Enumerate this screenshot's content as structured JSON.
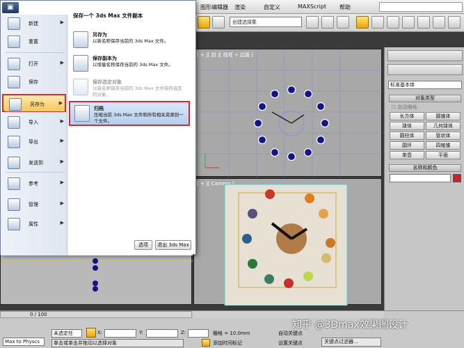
{
  "menubar": {
    "items": [
      "图形编辑器",
      "渲染",
      "自定义",
      "MAXScript",
      "帮助"
    ]
  },
  "toolbar": {
    "selection_set_placeholder": "创建选择集"
  },
  "viewports": {
    "top_label": "[ + ][ 前 ][ 线框 + 边面 ]",
    "camera_label": "[ + ][ Camera ]"
  },
  "app_menu": {
    "title": "保存一个 3ds Max 文件副本",
    "left_items": [
      {
        "label": "新建",
        "icon": "new-file-icon",
        "arrow": true
      },
      {
        "label": "重置",
        "icon": "reset-icon",
        "arrow": false
      },
      {
        "label": "打开",
        "icon": "open-folder-icon",
        "arrow": true
      },
      {
        "label": "保存",
        "icon": "save-icon",
        "arrow": false
      },
      {
        "label": "另存为",
        "icon": "save-as-icon",
        "arrow": true
      },
      {
        "label": "导入",
        "icon": "import-icon",
        "arrow": true
      },
      {
        "label": "导出",
        "icon": "export-icon",
        "arrow": true
      },
      {
        "label": "发送到",
        "icon": "send-to-icon",
        "arrow": true
      },
      {
        "label": "参考",
        "icon": "reference-icon",
        "arrow": true
      },
      {
        "label": "管理",
        "icon": "manage-icon",
        "arrow": true
      },
      {
        "label": "属性",
        "icon": "properties-icon",
        "arrow": true
      }
    ],
    "right_items": [
      {
        "title": "另存为",
        "desc": "以新名称保存当前的 3ds Max 文件。"
      },
      {
        "title": "保存副本为",
        "desc": "以增量名称保存当前的 3ds Max 文件。"
      },
      {
        "title": "保存选定对象",
        "desc": "以新名称保存当前的 3ds Max 文件保存选定的对象。"
      },
      {
        "title": "归档",
        "desc": "压缩当前 3ds Max 文件和所有相关资源到一个文件。"
      }
    ],
    "options_button": "选项",
    "exit_button": "退出 3ds Max"
  },
  "command_panel": {
    "dropdown": "标准基本体",
    "rollout_object_type": "对象类型",
    "autogrid_label": "自动栅格",
    "buttons": [
      "长方体",
      "圆锥体",
      "球体",
      "几何球体",
      "圆柱体",
      "管状体",
      "圆环",
      "四棱锥",
      "茶壶",
      "平面"
    ],
    "rollout_name_color": "名称和颜色",
    "swatch_color": "#c0282d"
  },
  "timeline": {
    "frame_readout": "0 / 100"
  },
  "status": {
    "script_listener": "Max to Physcs",
    "selection_status": "未选定任",
    "x_label": "X:",
    "y_label": "Y:",
    "z_label": "Z:",
    "grid": "栅格 = 10.0mm",
    "prompt": "单击或单击并拖动以选择对象",
    "add_time_tag": "添加时间标记",
    "auto_key": "自动关键点",
    "set_key": "设置关键点",
    "key_filters": "关键点过滤器..."
  },
  "watermark": "知乎 @3Dmax效果图设计"
}
